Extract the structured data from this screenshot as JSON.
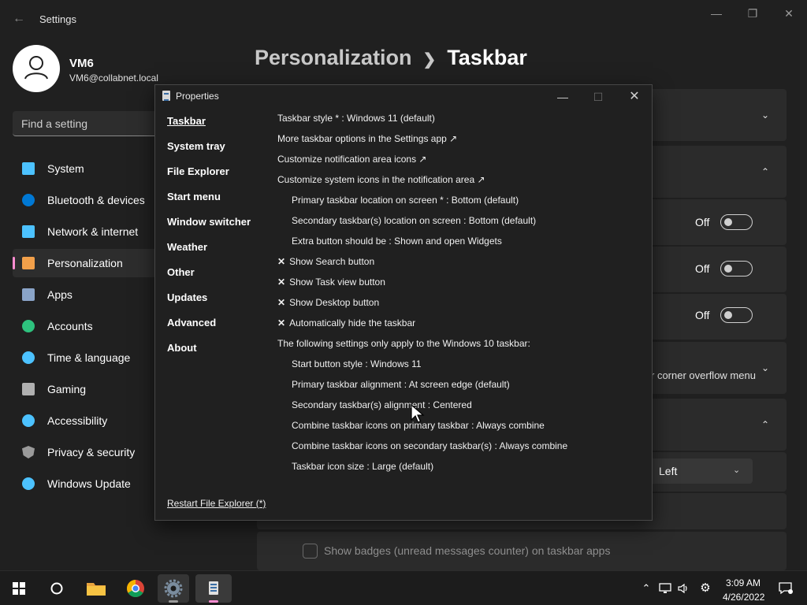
{
  "window": {
    "title": "Settings"
  },
  "user": {
    "name": "VM6",
    "email": "VM6@collabnet.local"
  },
  "search": {
    "placeholder": "Find a setting"
  },
  "nav": [
    {
      "label": "System",
      "icon": "monitor-icon",
      "color": "#4cc2ff"
    },
    {
      "label": "Bluetooth & devices",
      "icon": "bluetooth-icon",
      "color": "#0078d4"
    },
    {
      "label": "Network & internet",
      "icon": "wifi-icon",
      "color": "#4cc2ff"
    },
    {
      "label": "Personalization",
      "icon": "brush-icon",
      "color": "#f2a04a",
      "active": true
    },
    {
      "label": "Apps",
      "icon": "apps-icon",
      "color": "#8aa4c8"
    },
    {
      "label": "Accounts",
      "icon": "person-icon",
      "color": "#2ec27e"
    },
    {
      "label": "Time & language",
      "icon": "clock-globe-icon",
      "color": "#4cc2ff"
    },
    {
      "label": "Gaming",
      "icon": "gamepad-icon",
      "color": "#b0b0b0"
    },
    {
      "label": "Accessibility",
      "icon": "accessibility-icon",
      "color": "#4cc2ff"
    },
    {
      "label": "Privacy & security",
      "icon": "shield-icon",
      "color": "#9a9a9a"
    },
    {
      "label": "Windows Update",
      "icon": "update-icon",
      "color": "#4cc2ff"
    }
  ],
  "breadcrumb": {
    "parent": "Personalization",
    "current": "Taskbar"
  },
  "main": {
    "toggles": [
      {
        "state": "Off"
      },
      {
        "state": "Off"
      },
      {
        "state": "Off"
      }
    ],
    "overflow_text": "r corner overflow menu",
    "alignment_dropdown": {
      "value": "Left"
    },
    "badges_label": "Show badges (unread messages counter) on taskbar apps"
  },
  "properties": {
    "title": "Properties",
    "nav": [
      "Taskbar",
      "System tray",
      "File Explorer",
      "Start menu",
      "Window switcher",
      "Weather",
      "Other",
      "Updates",
      "Advanced",
      "About"
    ],
    "options": [
      {
        "text": "Taskbar style * : Windows 11 (default)",
        "indent": false,
        "x": false
      },
      {
        "text": "More taskbar options in the Settings app ↗",
        "indent": false,
        "x": false
      },
      {
        "text": "Customize notification area icons ↗",
        "indent": false,
        "x": false
      },
      {
        "text": "Customize system icons in the notification area ↗",
        "indent": false,
        "x": false
      },
      {
        "text": "Primary taskbar location on screen * : Bottom (default)",
        "indent": true,
        "x": false
      },
      {
        "text": "Secondary taskbar(s) location on screen : Bottom (default)",
        "indent": true,
        "x": false
      },
      {
        "text": "Extra button should be : Shown and open Widgets",
        "indent": true,
        "x": false
      },
      {
        "text": "Show Search button",
        "indent": false,
        "x": true
      },
      {
        "text": "Show Task view button",
        "indent": false,
        "x": true
      },
      {
        "text": "Show Desktop button",
        "indent": false,
        "x": true
      },
      {
        "text": "Automatically hide the taskbar",
        "indent": false,
        "x": true
      },
      {
        "text": "The following settings only apply to the Windows 10 taskbar:",
        "indent": false,
        "x": false
      },
      {
        "text": "Start button style : Windows 11",
        "indent": true,
        "x": false
      },
      {
        "text": "Primary taskbar alignment : At screen edge (default)",
        "indent": true,
        "x": false
      },
      {
        "text": "Secondary taskbar(s) alignment : Centered",
        "indent": true,
        "x": false
      },
      {
        "text": "Combine taskbar icons on primary taskbar : Always combine",
        "indent": true,
        "x": false
      },
      {
        "text": "Combine taskbar icons on secondary taskbar(s) : Always combine",
        "indent": true,
        "x": false
      },
      {
        "text": "Taskbar icon size : Large (default)",
        "indent": true,
        "x": false
      }
    ],
    "restart_link": "Restart File Explorer (*)"
  },
  "taskbar": {
    "apps": [
      "start-icon",
      "search-icon",
      "file-explorer-icon",
      "chrome-icon",
      "settings-icon",
      "properties-app-icon"
    ],
    "time": "3:09 AM",
    "date": "4/26/2022"
  }
}
